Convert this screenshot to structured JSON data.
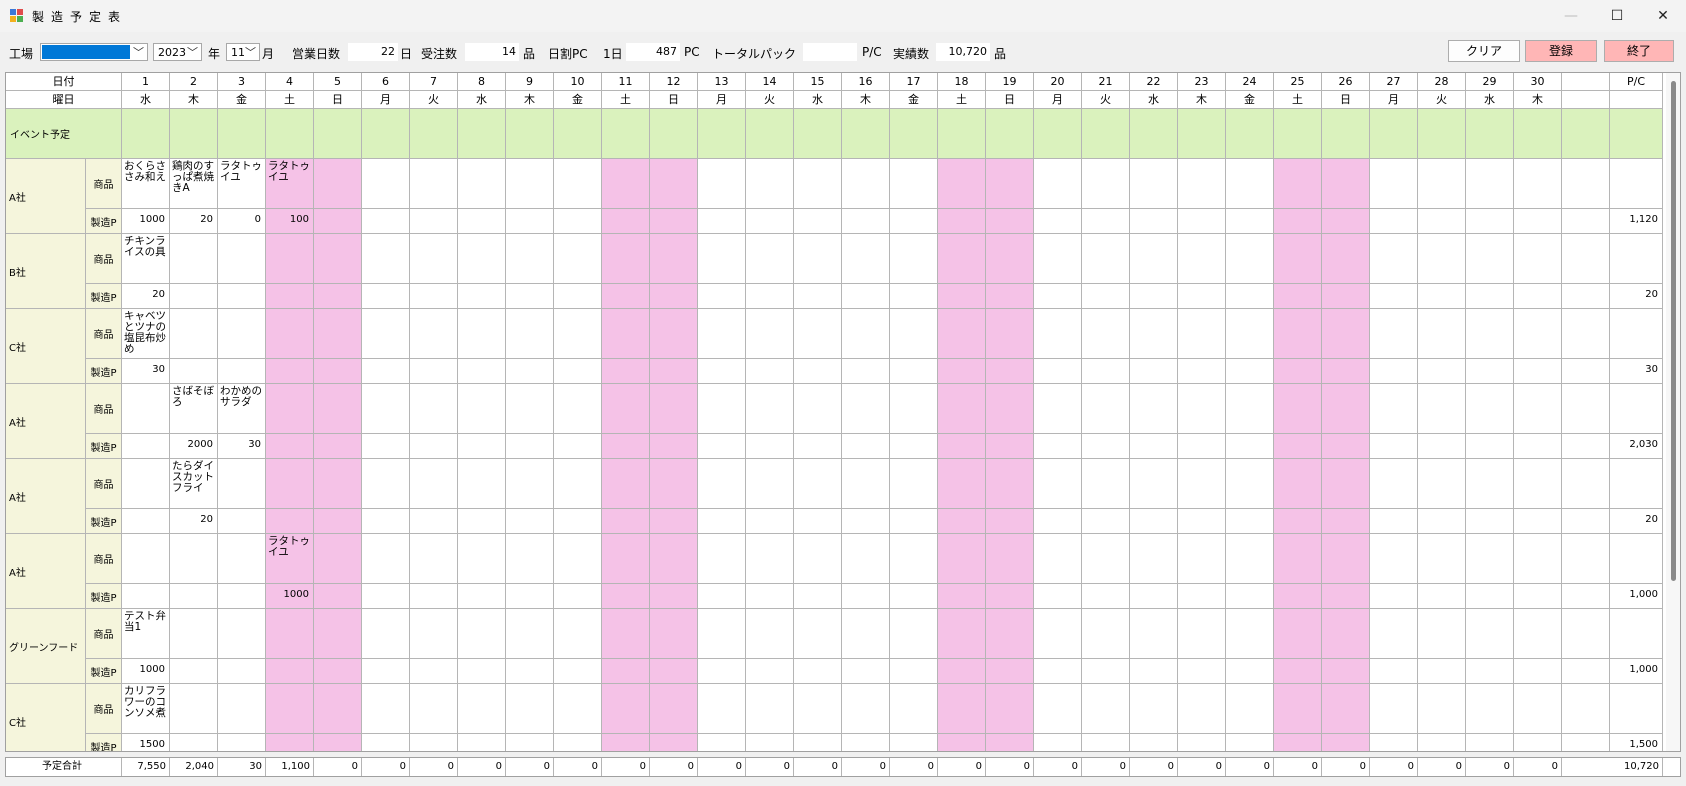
{
  "window": {
    "title": "製造予定表",
    "minimize_icon": "—",
    "maximize_icon": "☐",
    "close_icon": "✕"
  },
  "colors": {
    "weekend": "#f5c2e7",
    "event_row": "#daf2bd",
    "row_header": "#f5f5dc",
    "register": "#ffb6b6",
    "exit": "#ffb6b6"
  },
  "toolbar": {
    "factory_label": "工場",
    "factory_value": "",
    "year_value": "2023",
    "year_label": "年",
    "month_value": "11",
    "month_label": "月",
    "workdays_label": "営業日数",
    "workdays_value": "22",
    "workdays_unit": "日",
    "orders_label": "受注数",
    "orders_value": "14",
    "orders_unit": "品",
    "daily_pc_label": "日割PC",
    "per_day_label": "1日",
    "daily_pc_value": "487",
    "daily_pc_unit": "PC",
    "total_pack_label": "トータルパック",
    "total_pack_value": "",
    "total_pack_unit": "P/C",
    "actual_label": "実績数",
    "actual_value": "10,720",
    "actual_unit": "品",
    "clear_label": "クリア",
    "register_label": "登録",
    "exit_label": "終了"
  },
  "grid": {
    "date_header": "日付",
    "weekday_header": "曜日",
    "pc_header": "P/C",
    "event_label": "イベント予定",
    "product_label": "商品",
    "production_label": "製造P",
    "days": [
      "1",
      "2",
      "3",
      "4",
      "5",
      "6",
      "7",
      "8",
      "9",
      "10",
      "11",
      "12",
      "13",
      "14",
      "15",
      "16",
      "17",
      "18",
      "19",
      "20",
      "21",
      "22",
      "23",
      "24",
      "25",
      "26",
      "27",
      "28",
      "29",
      "30"
    ],
    "weekdays": [
      "水",
      "木",
      "金",
      "土",
      "日",
      "月",
      "火",
      "水",
      "木",
      "金",
      "土",
      "日",
      "月",
      "火",
      "水",
      "木",
      "金",
      "土",
      "日",
      "月",
      "火",
      "水",
      "木",
      "金",
      "土",
      "日",
      "月",
      "火",
      "水",
      "木"
    ],
    "weekend_days": [
      4,
      5,
      11,
      12,
      18,
      19,
      25,
      26
    ],
    "companies": [
      {
        "name": "A社",
        "products": {
          "1": "おくらささみ和え",
          "2": "鶏肉のすっぱ煮焼きA",
          "3": "ラタトゥイユ",
          "4": "ラタトゥイユ"
        },
        "quantities": {
          "1": "1000",
          "2": "20",
          "3": "0",
          "4": "100"
        },
        "total": "1,120"
      },
      {
        "name": "B社",
        "products": {
          "1": "チキンライスの具"
        },
        "quantities": {
          "1": "20"
        },
        "total": "20"
      },
      {
        "name": "C社",
        "products": {
          "1": "キャベツとツナの塩昆布炒め"
        },
        "quantities": {
          "1": "30"
        },
        "total": "30"
      },
      {
        "name": "A社",
        "products": {
          "2": "さばそぼろ",
          "3": "わかめのサラダ"
        },
        "quantities": {
          "2": "2000",
          "3": "30"
        },
        "total": "2,030"
      },
      {
        "name": "A社",
        "products": {
          "2": "たらダイスカットフライ"
        },
        "quantities": {
          "2": "20"
        },
        "total": "20"
      },
      {
        "name": "A社",
        "products": {
          "4": "ラタトゥイユ"
        },
        "quantities": {
          "4": "1000"
        },
        "total": "1,000"
      },
      {
        "name": "グリーンフード",
        "products": {
          "1": "テスト弁当1"
        },
        "quantities": {
          "1": "1000"
        },
        "total": "1,000"
      },
      {
        "name": "C社",
        "products": {
          "1": "カリフラワーのコンソメ煮"
        },
        "quantities": {
          "1": "1500"
        },
        "total": "1,500"
      }
    ]
  },
  "totals": {
    "label": "予定合計",
    "values": [
      "7,550",
      "2,040",
      "30",
      "1,100",
      "0",
      "0",
      "0",
      "0",
      "0",
      "0",
      "0",
      "0",
      "0",
      "0",
      "0",
      "0",
      "0",
      "0",
      "0",
      "0",
      "0",
      "0",
      "0",
      "0",
      "0",
      "0",
      "0",
      "0",
      "0",
      "0"
    ],
    "grand_total": "10,720"
  }
}
